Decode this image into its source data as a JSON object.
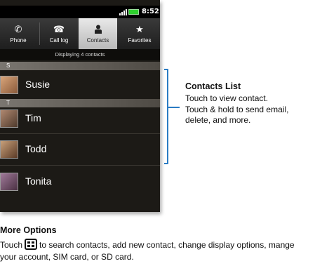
{
  "status_bar": {
    "time": "8:52"
  },
  "tabs": [
    {
      "label": "Phone",
      "icon": "phone-icon",
      "active": false
    },
    {
      "label": "Call log",
      "icon": "call-log-icon",
      "active": false
    },
    {
      "label": "Contacts",
      "icon": "contacts-icon",
      "active": true
    },
    {
      "label": "Favorites",
      "icon": "star-icon",
      "active": false
    }
  ],
  "display_count": "Displaying 4 contacts",
  "sections": [
    {
      "letter": "S"
    },
    {
      "letter": "T"
    }
  ],
  "contacts": [
    {
      "name": "Susie"
    },
    {
      "name": "Tim"
    },
    {
      "name": "Todd"
    },
    {
      "name": "Tonita"
    }
  ],
  "callout": {
    "title": "Contacts List",
    "text": "Touch to view contact. Touch & hold to send email, delete, and more."
  },
  "more_options": {
    "title": "More Options",
    "text_before": "Touch",
    "text_after": "to search contacts, add new contact, change display options, mange your account, SIM card, or SD card."
  },
  "colors": {
    "accent": "#2b7cc4",
    "battery": "#2fd12f"
  }
}
